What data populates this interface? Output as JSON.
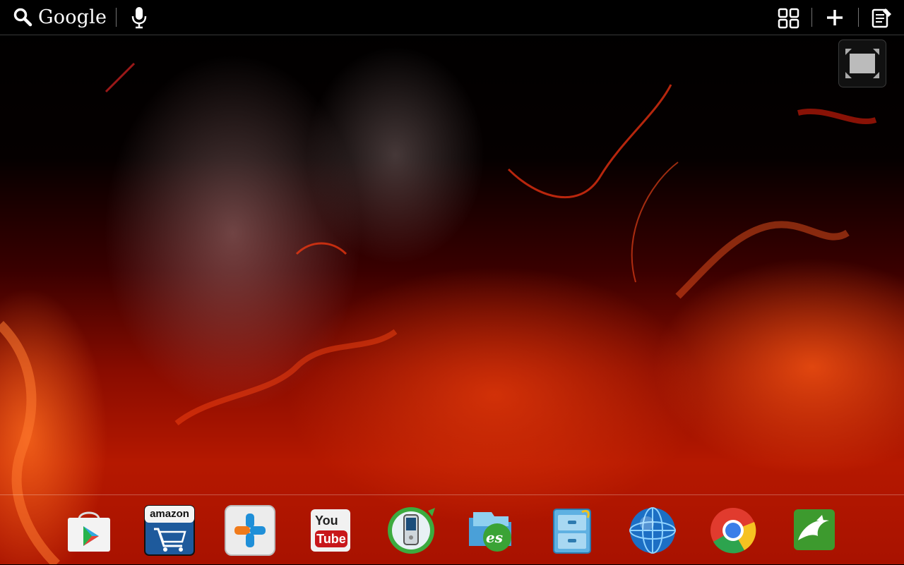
{
  "topbar": {
    "search_label": "Google",
    "icons": [
      "search-icon",
      "microphone-icon",
      "all-apps-grid-icon",
      "add-plus-icon",
      "notes-edit-icon"
    ]
  },
  "floating_button": {
    "icon": "fullscreen-toggle-icon"
  },
  "dock": {
    "apps": [
      {
        "id": "play-store",
        "icon": "play-store-icon"
      },
      {
        "id": "amazon",
        "icon": "amazon-shopping-icon",
        "text": "amazon"
      },
      {
        "id": "plus-app",
        "icon": "plus-cross-app-icon"
      },
      {
        "id": "youtube",
        "icon": "youtube-icon",
        "text_top": "You",
        "text_bottom": "Tube"
      },
      {
        "id": "phone-app",
        "icon": "phone-sync-icon"
      },
      {
        "id": "es-file-explorer",
        "icon": "es-file-explorer-icon",
        "text": "es"
      },
      {
        "id": "file-cabinet-app",
        "icon": "file-cabinet-icon"
      },
      {
        "id": "browser-globe",
        "icon": "globe-browser-icon"
      },
      {
        "id": "chrome",
        "icon": "chrome-icon"
      },
      {
        "id": "dolphin-browser",
        "icon": "dolphin-browser-icon"
      }
    ]
  },
  "colors": {
    "wallpaper_dark": "#000000",
    "wallpaper_fire": "#b51800",
    "youtube_red": "#c8171b",
    "amazon_blue": "#1e5a9c"
  }
}
